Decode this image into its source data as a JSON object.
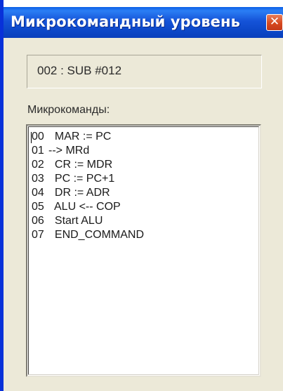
{
  "window": {
    "title": "Микрокомандный уровень",
    "close_symbol": "✕"
  },
  "current_command": "002 : SUB #012",
  "microcommands_label": "Микрокоманды:",
  "microcommands": [
    {
      "num": "00",
      "cmd": "  MAR := PC"
    },
    {
      "num": "01",
      "cmd": "--> MRd"
    },
    {
      "num": "02",
      "cmd": "  CR := MDR"
    },
    {
      "num": "03",
      "cmd": "  PC := PC+1"
    },
    {
      "num": "04",
      "cmd": "  DR := ADR"
    },
    {
      "num": "05",
      "cmd": "  ALU <-- COP"
    },
    {
      "num": "06",
      "cmd": "  Start ALU"
    },
    {
      "num": "07",
      "cmd": "  END_COMMAND"
    }
  ],
  "colors": {
    "titlebar": "#0a4fd6",
    "window_bg": "#ece9d8",
    "close_button": "#d7491f",
    "list_bg": "#ffffff"
  }
}
